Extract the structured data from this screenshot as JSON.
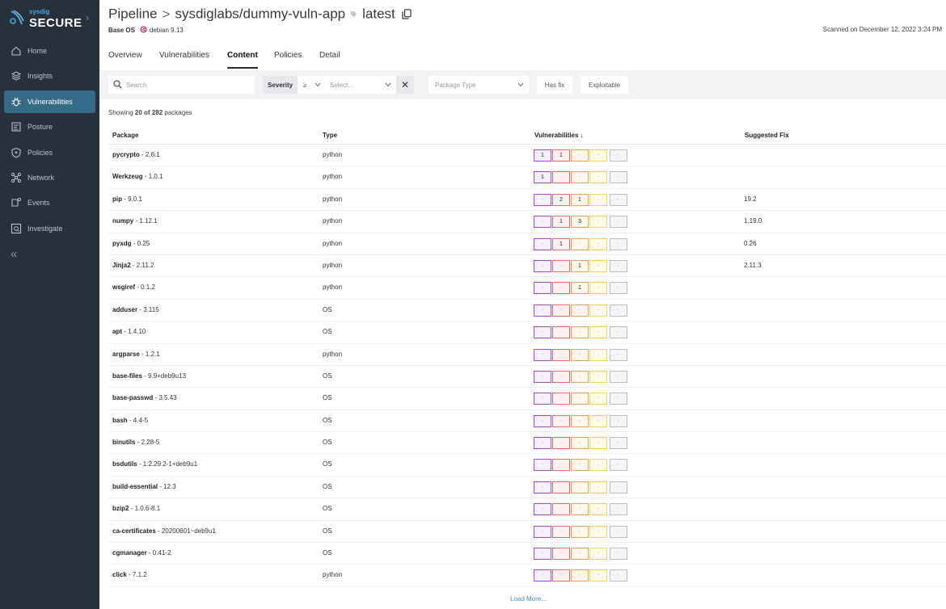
{
  "brand": {
    "small": "sysdig",
    "big": "SECURE"
  },
  "nav": [
    {
      "label": "Home",
      "icon": "home-icon"
    },
    {
      "label": "Insights",
      "icon": "insights-icon"
    },
    {
      "label": "Vulnerabilities",
      "icon": "bug-icon",
      "active": true
    },
    {
      "label": "Posture",
      "icon": "posture-icon"
    },
    {
      "label": "Policies",
      "icon": "shield-icon"
    },
    {
      "label": "Network",
      "icon": "network-icon"
    },
    {
      "label": "Events",
      "icon": "events-icon"
    },
    {
      "label": "Investigate",
      "icon": "investigate-icon"
    }
  ],
  "collapse_label": "«",
  "header": {
    "root": "Pipeline",
    "separator": ">",
    "image": "sysdiglabs/dummy-vuln-app",
    "tag": "latest",
    "base_os_label": "Base OS",
    "base_os_value": "debian 9.13",
    "scanned": "Scanned on December 12, 2022 3:24 PM"
  },
  "tabs": [
    "Overview",
    "Vulnerabilities",
    "Content",
    "Policies",
    "Detail"
  ],
  "active_tab": "Content",
  "filters": {
    "search_placeholder": "Search",
    "severity_label": "Severity",
    "severity_op": "≥",
    "severity_select_placeholder": "Select...",
    "clear": "✕",
    "package_type_placeholder": "Package Type",
    "has_fix": "Has fix",
    "exploitable": "Exploitable"
  },
  "showing": {
    "prefix": "Showing ",
    "count": "20 of 282",
    "suffix": " packages"
  },
  "columns": {
    "package": "Package",
    "type": "Type",
    "vulns": "Vulnerabilities ↓",
    "fix": "Suggested Fix"
  },
  "rows": [
    {
      "name": "pycrypto",
      "version": " - 2.6.1",
      "type": "python",
      "v": [
        "1",
        "1",
        "-",
        "-",
        "-"
      ],
      "fix": ""
    },
    {
      "name": "Werkzeug",
      "version": " - 1.0.1",
      "type": "python",
      "v": [
        "1",
        "-",
        "-",
        "-",
        "-"
      ],
      "fix": ""
    },
    {
      "name": "pip",
      "version": " - 9.0.1",
      "type": "python",
      "v": [
        "-",
        "2",
        "1",
        "-",
        "-"
      ],
      "fix": "19.2"
    },
    {
      "name": "numpy",
      "version": " - 1.12.1",
      "type": "python",
      "v": [
        "-",
        "1",
        "3",
        "-",
        "-"
      ],
      "fix": "1.19.0"
    },
    {
      "name": "pyxdg",
      "version": " - 0.25",
      "type": "python",
      "v": [
        "-",
        "1",
        "-",
        "-",
        "-"
      ],
      "fix": "0.26"
    },
    {
      "name": "Jinja2",
      "version": " - 2.11.2",
      "type": "python",
      "v": [
        "-",
        "-",
        "1",
        "-",
        "-"
      ],
      "fix": "2.11.3"
    },
    {
      "name": "wsgiref",
      "version": " - 0.1.2",
      "type": "python",
      "v": [
        "-",
        "-",
        "1",
        "-",
        "-"
      ],
      "fix": ""
    },
    {
      "name": "adduser",
      "version": " - 3.115",
      "type": "OS",
      "v": [
        "-",
        "-",
        "-",
        "-",
        "-"
      ],
      "fix": ""
    },
    {
      "name": "apt",
      "version": " - 1.4.10",
      "type": "OS",
      "v": [
        "-",
        "-",
        "-",
        "-",
        "-"
      ],
      "fix": ""
    },
    {
      "name": "argparse",
      "version": " - 1.2.1",
      "type": "python",
      "v": [
        "-",
        "-",
        "-",
        "-",
        "-"
      ],
      "fix": ""
    },
    {
      "name": "base-files",
      "version": " - 9.9+deb9u13",
      "type": "OS",
      "v": [
        "-",
        "-",
        "-",
        "-",
        "-"
      ],
      "fix": ""
    },
    {
      "name": "base-passwd",
      "version": " - 3.5.43",
      "type": "OS",
      "v": [
        "-",
        "-",
        "-",
        "-",
        "-"
      ],
      "fix": ""
    },
    {
      "name": "bash",
      "version": " - 4.4-5",
      "type": "OS",
      "v": [
        "-",
        "-",
        "-",
        "-",
        "-"
      ],
      "fix": ""
    },
    {
      "name": "binutils",
      "version": " - 2.28-5",
      "type": "OS",
      "v": [
        "-",
        "-",
        "-",
        "-",
        "-"
      ],
      "fix": ""
    },
    {
      "name": "bsdutils",
      "version": " - 1:2.29.2-1+deb9u1",
      "type": "OS",
      "v": [
        "-",
        "-",
        "-",
        "-",
        "-"
      ],
      "fix": ""
    },
    {
      "name": "build-essential",
      "version": " - 12.3",
      "type": "OS",
      "v": [
        "-",
        "-",
        "-",
        "-",
        "-"
      ],
      "fix": ""
    },
    {
      "name": "bzip2",
      "version": " - 1.0.6-8.1",
      "type": "OS",
      "v": [
        "-",
        "-",
        "-",
        "-",
        "-"
      ],
      "fix": ""
    },
    {
      "name": "ca-certificates",
      "version": " - 20200601~deb9u1",
      "type": "OS",
      "v": [
        "-",
        "-",
        "-",
        "-",
        "-"
      ],
      "fix": ""
    },
    {
      "name": "cgmanager",
      "version": " - 0.41-2",
      "type": "OS",
      "v": [
        "-",
        "-",
        "-",
        "-",
        "-"
      ],
      "fix": ""
    },
    {
      "name": "click",
      "version": " - 7.1.2",
      "type": "python",
      "v": [
        "-",
        "-",
        "-",
        "-",
        "-"
      ],
      "fix": ""
    }
  ],
  "load_more": "Load More..."
}
